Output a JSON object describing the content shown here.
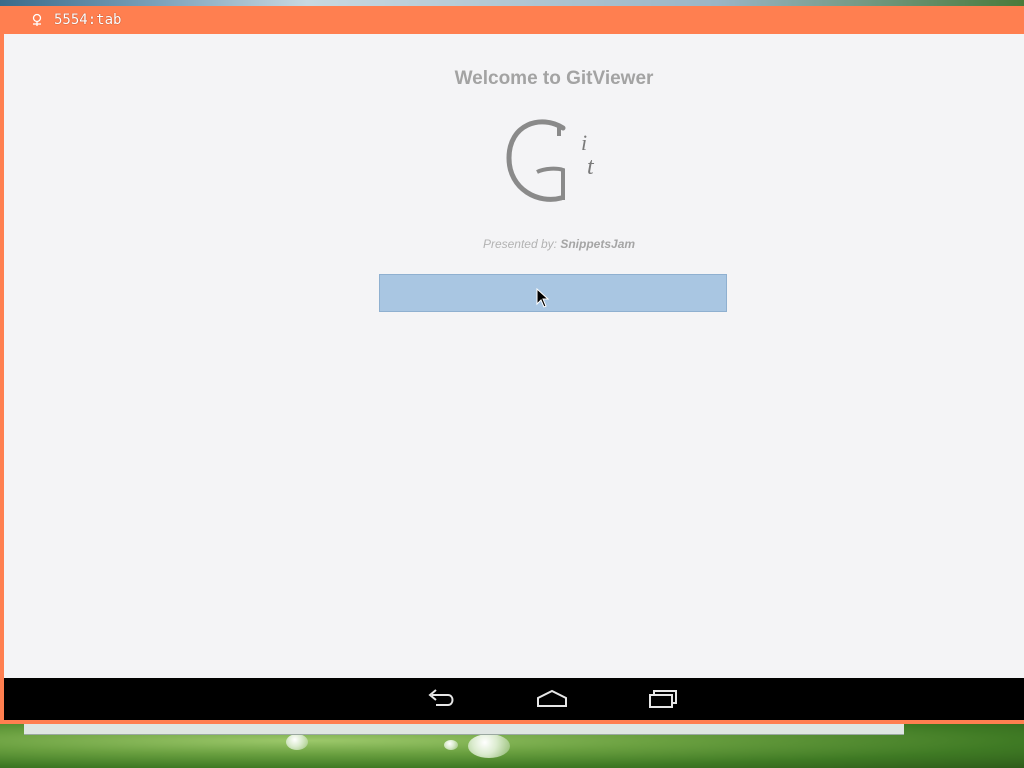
{
  "window": {
    "title": "5554:tab",
    "title_icon": "android-robot-icon",
    "frame_color": "#ff7f50"
  },
  "app": {
    "welcome_title": "Welcome to GitViewer",
    "logo_icon": "gitviewer-logo-icon",
    "presented_prefix": "Presented by: ",
    "presented_brand": "SnippetsJam",
    "main_button_label": "",
    "button_color": "#a9c6e2",
    "background_color": "#f4f4f6"
  },
  "navbar": {
    "back_icon": "back-icon",
    "home_icon": "home-icon",
    "recents_icon": "recent-apps-icon"
  }
}
